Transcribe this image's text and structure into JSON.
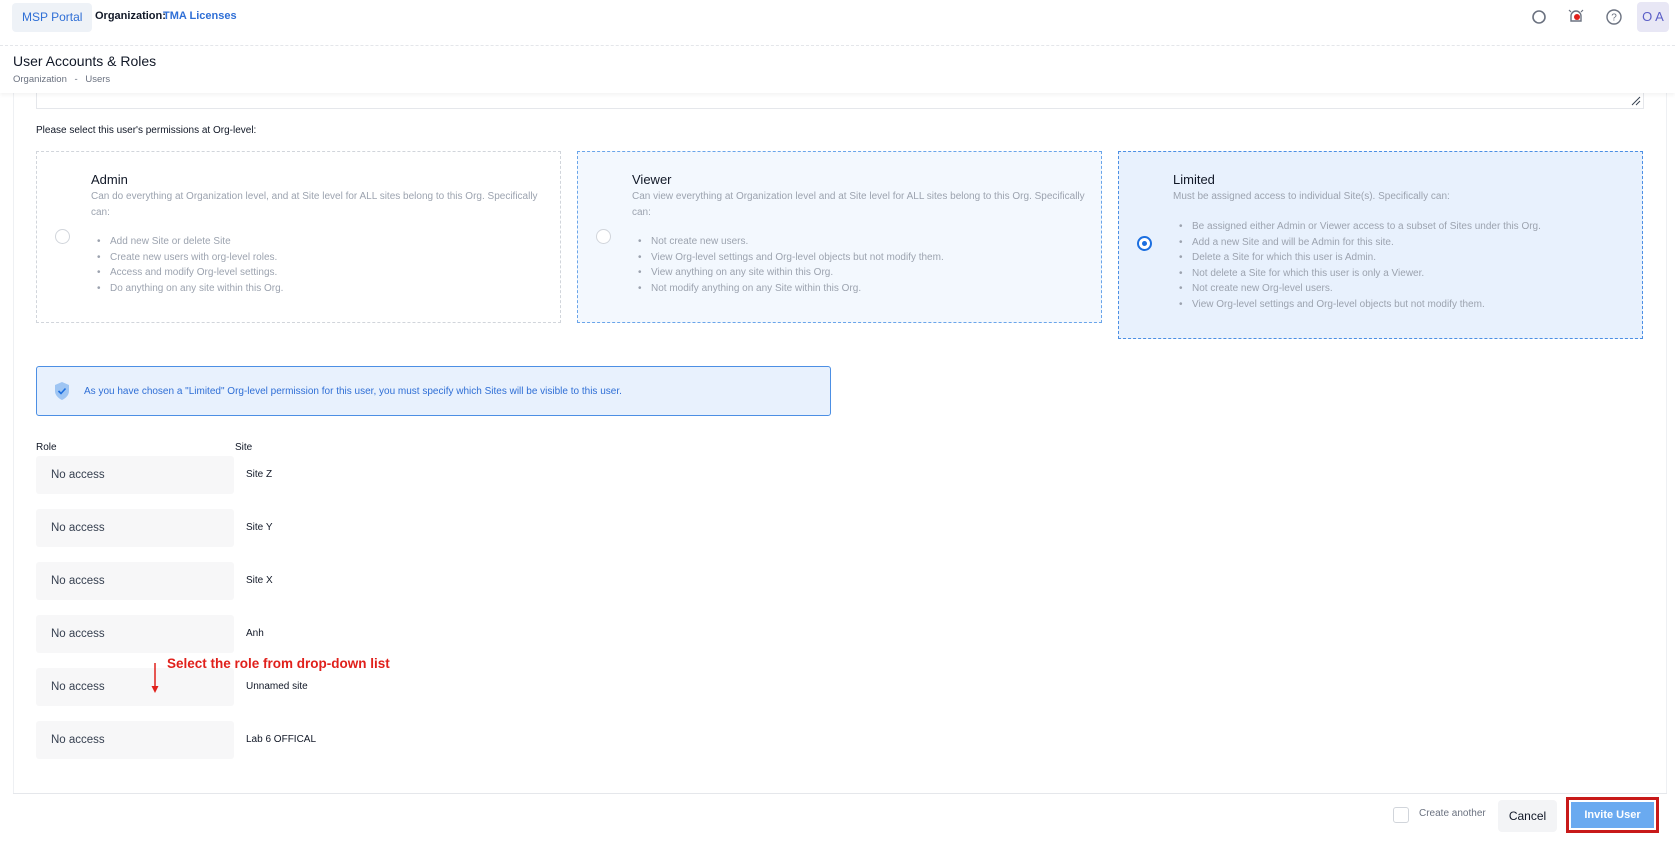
{
  "topbar": {
    "portal_label": "MSP Portal",
    "org_label": "Organization:",
    "org_name": "TMA Licenses",
    "avatar_initials": "O A",
    "icons": [
      "search-icon",
      "alarm-icon",
      "help-icon"
    ]
  },
  "header": {
    "title": "User Accounts & Roles",
    "breadcrumb": [
      "Organization",
      "-",
      "Users"
    ]
  },
  "permissions": {
    "prompt": "Please select this user's permissions at Org-level:",
    "selected": "Limited",
    "options": [
      {
        "title": "Admin",
        "description": "Can do everything at Organization level, and at Site level for ALL sites belong to this Org. Specifically can:",
        "items": [
          "Add new Site or delete Site",
          "Create new users with org-level roles.",
          "Access and modify Org-level settings.",
          "Do anything on any site within this Org."
        ]
      },
      {
        "title": "Viewer",
        "description": "Can view everything at Organization level and at Site level for ALL sites belong to this Org. Specifically can:",
        "items": [
          "Not create new users.",
          "View Org-level settings and Org-level objects but not modify them.",
          "View anything on any site within this Org.",
          "Not modify anything on any Site within this Org."
        ]
      },
      {
        "title": "Limited",
        "description": "Must be assigned access to individual Site(s). Specifically can:",
        "items": [
          "Be assigned either Admin or Viewer access to a subset of Sites under this Org.",
          "Add a new Site and will be Admin for this site.",
          "Delete a Site for which this user is Admin.",
          "Not delete a Site for which this user is only a Viewer.",
          "Not create new Org-level users.",
          "View Org-level settings and Org-level objects but not modify them."
        ]
      }
    ]
  },
  "notice": {
    "text": "As you have chosen a \"Limited\" Org-level permission for this user, you must specify which Sites will be visible to this user."
  },
  "site_table": {
    "headers": [
      "Role",
      "Site"
    ],
    "rows": [
      {
        "role": "No access",
        "site": "Site Z"
      },
      {
        "role": "No access",
        "site": "Site Y"
      },
      {
        "role": "No access",
        "site": "Site X"
      },
      {
        "role": "No access",
        "site": "Anh"
      },
      {
        "role": "No access",
        "site": "Unnamed site"
      },
      {
        "role": "No access",
        "site": "Lab 6 OFFICAL"
      }
    ]
  },
  "annotation": {
    "text": "Select the role from drop-down list",
    "color": "#e0201b"
  },
  "footer": {
    "create_another_label": "Create another",
    "create_another_checked": false,
    "cancel_label": "Cancel",
    "invite_label": "Invite User"
  },
  "colors": {
    "accent": "#2f6fd6",
    "selected_radio": "#1c6fe0",
    "invite_button": "#6aaaf0",
    "highlight_outline": "#c81919"
  }
}
